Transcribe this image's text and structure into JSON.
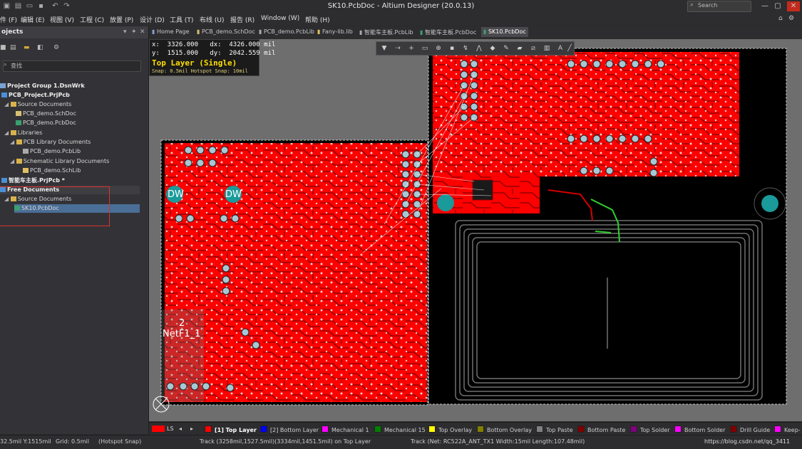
{
  "window": {
    "title": "SK10.PcbDoc - Altium Designer (20.0.13)",
    "search_placeholder": "Search"
  },
  "menu": [
    "件 (F)",
    "编辑 (E)",
    "视图 (V)",
    "工程 (C)",
    "放置 (P)",
    "设计 (D)",
    "工具 (T)",
    "布线 (U)",
    "报告 (R)",
    "Window (W)",
    "帮助 (H)"
  ],
  "projects_panel": {
    "title": "ojects",
    "search_placeholder": "查找",
    "tree": [
      {
        "label": "Project Group 1.DsnWrk",
        "bold": true
      },
      {
        "label": "PCB_Project.PrjPcb",
        "bold": true
      },
      {
        "label": "Source Documents"
      },
      {
        "label": "PCB_demo.SchDoc"
      },
      {
        "label": "PCB_demo.PcbDoc"
      },
      {
        "label": "Libraries"
      },
      {
        "label": "PCB Library Documents"
      },
      {
        "label": "PCB_demo.PcbLib"
      },
      {
        "label": "Schematic Library Documents"
      },
      {
        "label": "PCB_demo.SchLib"
      },
      {
        "label": "智能车主板.PrjPcb *",
        "bold": true
      },
      {
        "label": "Free Documents",
        "bold": true
      },
      {
        "label": "Source Documents"
      },
      {
        "label": "SK10.PcbDoc",
        "selected": true
      }
    ]
  },
  "tabs": [
    "Home Page",
    "PCB_demo.SchDoc",
    "PCB_demo.PcbLib",
    "Fany-lib.lib",
    "智能车主板.PcbLib",
    "智能车主板.PcbDoc",
    "SK10.PcbDoc"
  ],
  "active_tab": "SK10.PcbDoc",
  "coords": {
    "x_line": "x:  3326.000   dx:  4326.000 mil",
    "y_line": "y:  1515.000   dy:  2042.559 mil",
    "layer": "Top Layer (Single)",
    "snap": "Snap: 0.5mil Hotspot Snap: 10mil"
  },
  "board": {
    "designators": [
      "DW",
      "DW"
    ],
    "net_label_num": "2",
    "net_label": "NetF1_1"
  },
  "layers": [
    {
      "label": "[1] Top Layer",
      "color": "#ff0000",
      "active": true
    },
    {
      "label": "[2] Bottom Layer",
      "color": "#0000ff"
    },
    {
      "label": "Mechanical 1",
      "color": "#ff00ff"
    },
    {
      "label": "Mechanical 15",
      "color": "#008000"
    },
    {
      "label": "Top Overlay",
      "color": "#ffff00"
    },
    {
      "label": "Bottom Overlay",
      "color": "#808000"
    },
    {
      "label": "Top Paste",
      "color": "#808080"
    },
    {
      "label": "Bottom Paste",
      "color": "#800000"
    },
    {
      "label": "Top Solder",
      "color": "#800080"
    },
    {
      "label": "Bottom Solder",
      "color": "#ff00ff"
    },
    {
      "label": "Drill Guide",
      "color": "#800000"
    },
    {
      "label": "Keep-",
      "color": "#ff00ff"
    }
  ],
  "layer_set": "LS",
  "status": {
    "coords": "32.5mil Y:1515mil",
    "grid": "Grid: 0.5mil",
    "snap": "(Hotspot Snap)",
    "track1": "Track (3258mil,1527.5mil)(3334mil,1451.5mil) on Top Layer",
    "track2": "Track (Net: RC522A_ANT_TX1 Width:15mil Length:107.48mil)",
    "watermark": "https://blog.csdn.net/qq_3411"
  },
  "colors": {
    "top_layer": "#ff0000",
    "board_black": "#000000",
    "canvas": "#6e6e6e",
    "pad_teal": "#1a9a9a",
    "selection": "#4a6e96"
  }
}
